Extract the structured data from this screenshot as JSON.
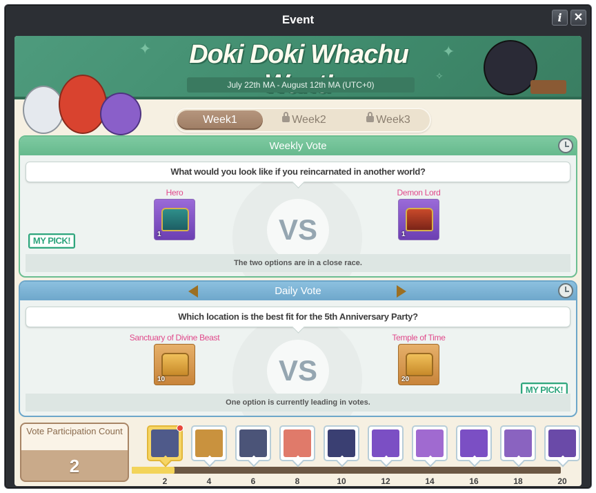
{
  "window": {
    "title": "Event"
  },
  "banner": {
    "title": "Doki Doki Whachu Want!",
    "dates": "July 22th MA - August 12th MA (UTC+0)"
  },
  "tabs": [
    {
      "label": "Week1",
      "locked": false,
      "active": true
    },
    {
      "label": "Week2",
      "locked": true,
      "active": false
    },
    {
      "label": "Week3",
      "locked": true,
      "active": false
    }
  ],
  "weekly_vote": {
    "header": "Weekly Vote",
    "question": "What would you look like if you reincarnated in another world?",
    "vs": "VS",
    "option_a": {
      "name": "Hero",
      "qty": "1"
    },
    "option_b": {
      "name": "Demon Lord",
      "qty": "1"
    },
    "my_pick": "MY PICK!",
    "status": "The two options are in a close race."
  },
  "daily_vote": {
    "header": "Daily Vote",
    "question": "Which location is the best fit for the 5th Anniversary Party?",
    "vs": "VS",
    "option_a": {
      "name": "Sanctuary of Divine Beast",
      "qty": "10"
    },
    "option_b": {
      "name": "Temple of Time",
      "qty": "20"
    },
    "my_pick": "MY PICK!",
    "status": "One option is currently leading in votes."
  },
  "participation": {
    "label": "Vote Participation Count",
    "count": "2",
    "progress": 0.1
  },
  "rewards": [
    {
      "milestone": "2",
      "qty": "",
      "claimed": true,
      "color": "#4f5a8a"
    },
    {
      "milestone": "4",
      "qty": "",
      "claimed": false,
      "color": "#c9923e"
    },
    {
      "milestone": "6",
      "qty": "",
      "claimed": false,
      "color": "#4b5478"
    },
    {
      "milestone": "8",
      "qty": "",
      "claimed": false,
      "color": "#e07a6a"
    },
    {
      "milestone": "10",
      "qty": "",
      "claimed": false,
      "color": "#3a3f72"
    },
    {
      "milestone": "12",
      "qty": "",
      "claimed": false,
      "color": "#7b4fc4"
    },
    {
      "milestone": "14",
      "qty": "",
      "claimed": false,
      "color": "#a06ad0"
    },
    {
      "milestone": "16",
      "qty": "",
      "claimed": false,
      "color": "#7b4fc4"
    },
    {
      "milestone": "18",
      "qty": "",
      "claimed": false,
      "color": "#8a63c0"
    },
    {
      "milestone": "20",
      "qty": "",
      "claimed": false,
      "color": "#6a4aa8"
    }
  ],
  "icons": {
    "info": "i",
    "close": "✕"
  }
}
